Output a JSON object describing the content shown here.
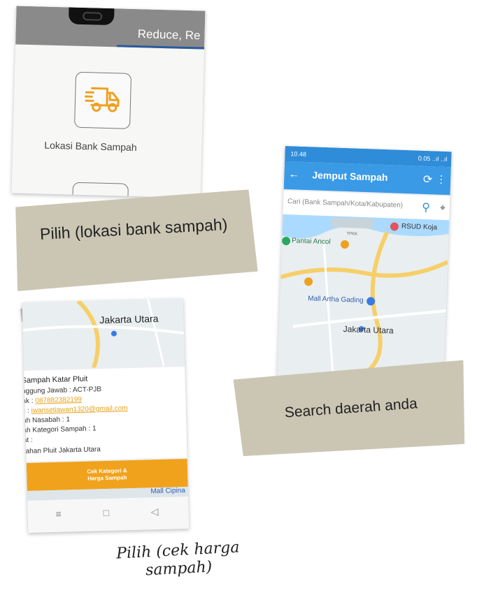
{
  "shot1": {
    "header_text": "Reduce, Re",
    "tile_label": "Lokasi Bank Sampah"
  },
  "tape1": {
    "text": "Pilih (lokasi bank sampah)"
  },
  "shot2": {
    "status_time": "10.48",
    "status_right": "0.05 ..ıl ..ıl",
    "title": "Jemput Sampah",
    "search_placeholder": "Cari (Bank Sampah/Kota/Kabupaten)",
    "map_labels": {
      "rsud": "RSUD Koja",
      "ancol": "Pantai Ancol",
      "mall": "Mall Artha Gading",
      "jakarta": "Jakarta Utara",
      "tpkk": "TPKK"
    }
  },
  "tape2": {
    "text": "Search daerah anda"
  },
  "shot3": {
    "city": "Jakarta Utara",
    "name": "Sampah Katar Pluit",
    "pj_label": "nggung Jawab :",
    "pj_value": "ACT-PJB",
    "tel_label": "ak :",
    "tel_value": "087882382199",
    "email_label": "il :",
    "email_value": "iwansetiawan1320@gmail.com",
    "nasabah_label": "ah Nasabah :",
    "nasabah_value": "1",
    "kategori_label": "ah Kategori Sampah :",
    "kategori_value": "1",
    "alamat_label": "at :",
    "alamat_value": "rahan Pluit Jakarta Utara",
    "button_line1": "Cek Kategori &",
    "button_line2": "Harga Sampah",
    "mall": "Mall Cipina"
  },
  "caption": {
    "line1": "Pilih (cek harga",
    "line2": "sampah)"
  },
  "colors": {
    "orange": "#f1a21c",
    "blue": "#3a9ae6",
    "tape": "#cbc6b4"
  }
}
